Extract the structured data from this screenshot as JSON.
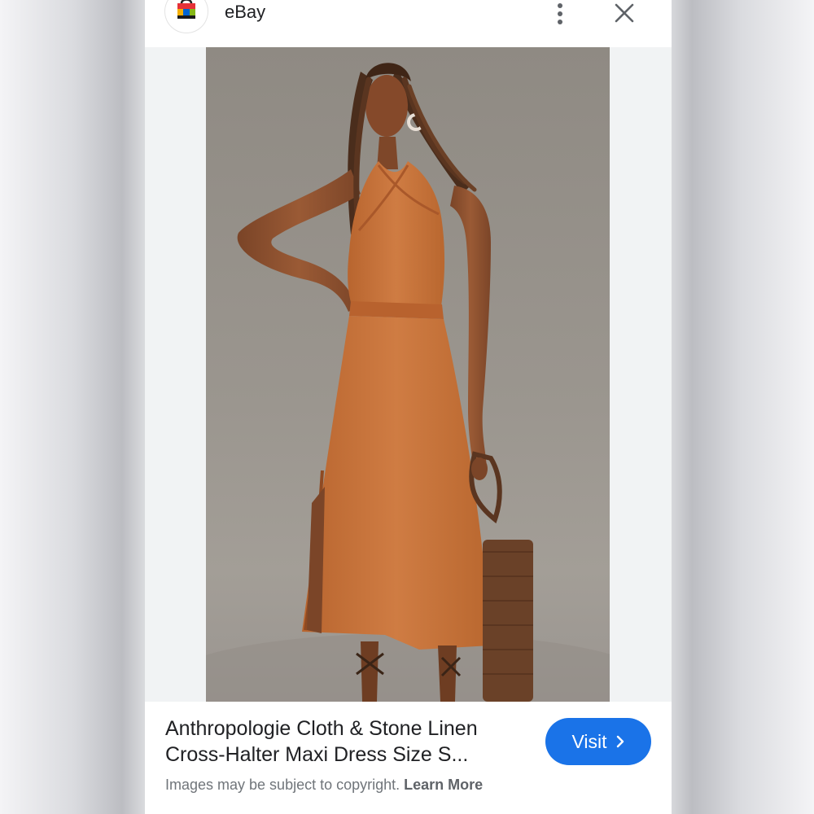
{
  "header": {
    "site_name": "eBay",
    "icons": [
      "shopping-bag-icon",
      "more-vert-icon",
      "close-icon"
    ]
  },
  "result": {
    "title_line1": "Anthropologie Cloth & Stone Linen",
    "title_line2": "Cross-Halter Maxi Dress Size S...",
    "visit_label": "Visit",
    "copyright_text": "Images may be subject to copyright.",
    "learn_more_label": "Learn More"
  },
  "colors": {
    "accent": "#1a73e8",
    "dress": "#c8763f",
    "photo_background": "#8f8a83"
  }
}
